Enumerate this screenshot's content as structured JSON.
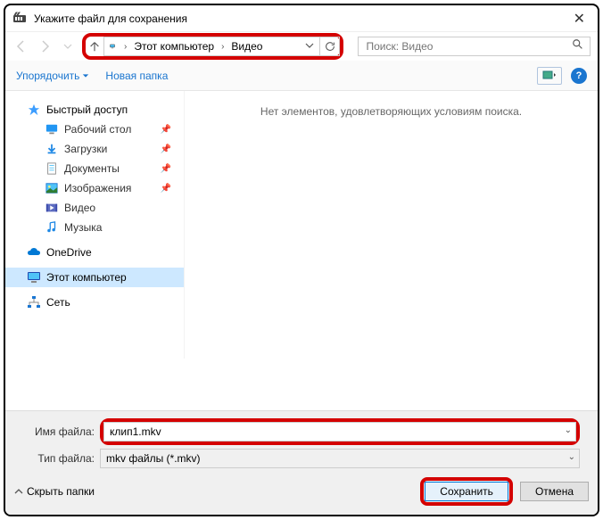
{
  "window": {
    "title": "Укажите файл для сохранения"
  },
  "address": {
    "root_icon": "monitor",
    "segments": [
      "Этот компьютер",
      "Видео"
    ]
  },
  "search": {
    "placeholder": "Поиск: Видео"
  },
  "toolbar": {
    "organize": "Упорядочить",
    "newfolder": "Новая папка"
  },
  "nav": {
    "quick_access": "Быстрый доступ",
    "desktop": "Рабочий стол",
    "downloads": "Загрузки",
    "documents": "Документы",
    "pictures": "Изображения",
    "videos": "Видео",
    "music": "Музыка",
    "onedrive": "OneDrive",
    "thispc": "Этот компьютер",
    "network": "Сеть"
  },
  "main": {
    "empty": "Нет элементов, удовлетворяющих условиям поиска."
  },
  "fields": {
    "filename_label": "Имя файла:",
    "filename_value": "клип1.mkv",
    "filetype_label": "Тип файла:",
    "filetype_value": "mkv файлы (*.mkv)"
  },
  "actions": {
    "hide_folders": "Скрыть папки",
    "save": "Сохранить",
    "cancel": "Отмена"
  }
}
